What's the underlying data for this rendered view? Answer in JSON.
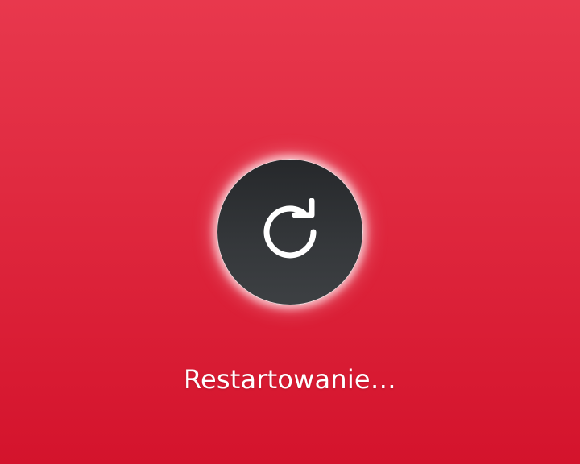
{
  "status": {
    "text": "Restartowanie…"
  },
  "icon": {
    "name": "restart-icon"
  },
  "colors": {
    "background_top": "#e8384d",
    "background_bottom": "#d4132c",
    "circle": "#2e3134",
    "text": "#ffffff"
  }
}
